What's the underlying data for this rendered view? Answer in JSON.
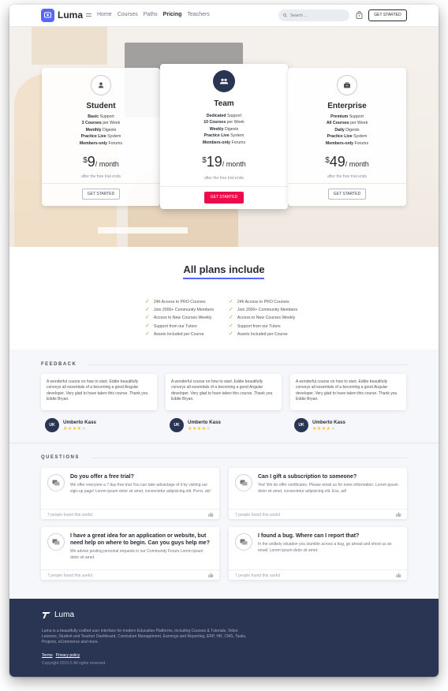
{
  "nav": {
    "brand": "Luma",
    "links": [
      "Home",
      "Courses",
      "Paths",
      "Pricing",
      "Teachers"
    ],
    "active_link": "Pricing",
    "search_placeholder": "Search ...",
    "cta": "GET STARTED"
  },
  "pricing": {
    "plans": [
      {
        "name": "Student",
        "icon": "user-icon",
        "features": [
          {
            "bold": "Basic",
            "text": " Support"
          },
          {
            "bold": "3 Courses",
            "text": " per Week"
          },
          {
            "bold": "Monthly",
            "text": " Digests"
          },
          {
            "bold": "Practice Live",
            "text": " System"
          },
          {
            "bold": "Members-only",
            "text": " Forums"
          }
        ],
        "currency": "$",
        "price": "9",
        "period": "/ month",
        "trial": "after the free trial ends",
        "button": "GET STARTED"
      },
      {
        "name": "Team",
        "icon": "group-icon",
        "features": [
          {
            "bold": "Dedicated",
            "text": " Support"
          },
          {
            "bold": "10 Courses",
            "text": " per Week"
          },
          {
            "bold": "Weekly",
            "text": " Digests"
          },
          {
            "bold": "Practice Live",
            "text": " System"
          },
          {
            "bold": "Members-only",
            "text": " Forums"
          }
        ],
        "currency": "$",
        "price": "19",
        "period": "/ month",
        "trial": "after the free trial ends",
        "button": "GET STARTED"
      },
      {
        "name": "Enterprise",
        "icon": "briefcase-icon",
        "features": [
          {
            "bold": "Premium",
            "text": " Support"
          },
          {
            "bold": "All Courses",
            "text": " per Week"
          },
          {
            "bold": "Daily",
            "text": " Digests"
          },
          {
            "bold": "Practice Live",
            "text": " System"
          },
          {
            "bold": "Members-only",
            "text": " Forums"
          }
        ],
        "currency": "$",
        "price": "49",
        "period": "/ month",
        "trial": "after the free trial ends",
        "button": "GET STARTED"
      }
    ]
  },
  "includes": {
    "title": "All plans include",
    "left": [
      "24h Access to PRO Courses",
      "Join 2000+ Community Members",
      "Access to New Courses Weekly",
      "Support from our Tutors",
      "Assets Included per Course"
    ],
    "right": [
      "24h Access to PRO Courses",
      "Join 2000+ Community Members",
      "Access to New Courses Weekly",
      "Support from our Tutors",
      "Assets Included per Course"
    ]
  },
  "feedback": {
    "heading": "FEEDBACK",
    "items": [
      {
        "text": "A wonderful course on how to start. Eddie beautifully conveys all essentials of a becoming a good Angular developer. Very glad to have taken this course. Thank you Eddie Bryan.",
        "initials": "UK",
        "name": "Umberto Kass",
        "rating": 4
      },
      {
        "text": "A wonderful course on how to start. Eddie beautifully conveys all essentials of a becoming a good Angular developer. Very glad to have taken this course. Thank you Eddie Bryan.",
        "initials": "UK",
        "name": "Umberto Kass",
        "rating": 4
      },
      {
        "text": "A wonderful course on how to start. Eddie beautifully conveys all essentials of a becoming a good Angular developer. Very glad to have taken this course. Thank you Eddie Bryan.",
        "initials": "UK",
        "name": "Umberto Kass",
        "rating": 4
      }
    ]
  },
  "questions": {
    "heading": "QUESTIONS",
    "items": [
      {
        "title": "Do you offer a free trial?",
        "body": "We offer everyone a 7 day free trial You can take advantage of it by visiting our sign-up page! Lorem ipsum dolor sit amet, consectetur adipisicing elit. Porro, ab!",
        "useful": "7 people found this useful"
      },
      {
        "title": "Can I gift a subscription to someone?",
        "body": "Yes! We do offer certificates. Please email us for more information. Lorem ipsum dolor sit amet, consectetur adipisicing elit. Eos, ad!",
        "useful": "7 people found this useful"
      },
      {
        "title": "I have a great idea for an application or website, but need help on where to begin. Can you guys help me?",
        "body": "We advise posting personal requests in our Community Forum Lorem ipsum dolor sit amet.",
        "useful": "7 people found this useful"
      },
      {
        "title": "I found a bug. Where can I report that?",
        "body": "In the unlikely situation you stumble across a bug, go ahead and shoot us an email. Lorem ipsum dolor sit amet.",
        "useful": "7 people found this useful"
      }
    ]
  },
  "footer": {
    "brand": "Luma",
    "description": "Luma is a beautifully crafted user interface for modern Education Platforms, including Courses & Tutorials, Video Lessons, Student and Teacher Dashboard, Curriculum Management, Earnings and Reporting, ERP, HR, CMS, Tasks, Projects, eCommerce and more.",
    "links": [
      "Terms",
      "Privacy policy"
    ],
    "copyright": "Copyright 2019 © All rights reserved."
  },
  "colors": {
    "brand": "#5567ff",
    "accent_red": "#ed0b4c",
    "navy": "#2a3553",
    "star": "#f9c032",
    "check": "#77c13a"
  }
}
